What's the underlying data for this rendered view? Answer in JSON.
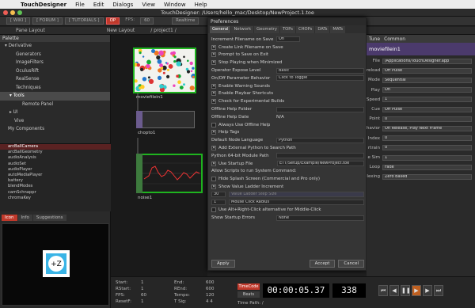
{
  "menubar": {
    "apple": "",
    "app": "TouchDesigner",
    "items": [
      "File",
      "Edit",
      "Dialogs",
      "View",
      "Window",
      "Help"
    ]
  },
  "window": {
    "title": "TouchDesigner: /Users/hello_mac/Desktop/NewProject.1.toe"
  },
  "toolbar": {
    "items": [
      "[ WIKI ]",
      "[ FORUM ]",
      "[ TUTORIALS ]",
      "OP",
      "FPS:",
      "60",
      "Realtime"
    ]
  },
  "pathbar": {
    "pane_layout": "Pane Layout",
    "new_layout": "New Layout",
    "path": "/ project1 /"
  },
  "palette": {
    "title": "Palette",
    "tree": [
      {
        "label": "Derivative",
        "level": 0,
        "open": true
      },
      {
        "label": "Generators",
        "level": 2
      },
      {
        "label": "ImageFilters",
        "level": 2
      },
      {
        "label": "OculusRift",
        "level": 2
      },
      {
        "label": "RealSense",
        "level": 2
      },
      {
        "label": "Techniques",
        "level": 2
      },
      {
        "label": "Tools",
        "level": 1,
        "open": true,
        "selected": true
      },
      {
        "label": "Remote Panel",
        "level": 3
      },
      {
        "label": "UI",
        "level": 1
      },
      {
        "label": "Vive",
        "level": 1
      },
      {
        "label": "My Components",
        "level": 0
      }
    ],
    "components": [
      "arcBallCamera",
      "arcBallGeometry",
      "audioAnalysis",
      "audioSet",
      "audioPlayer",
      "autoMediaPlayer",
      "battery",
      "blendModes",
      "camSchnappr",
      "chromaKey"
    ],
    "tabs": [
      "Icon",
      "Info",
      "Suggestions"
    ],
    "selected_component": "arcBallCamera"
  },
  "network": {
    "op1": "moviefilein1",
    "op2": "chopto1",
    "op3": "noise1"
  },
  "prefs": {
    "title": "Preferences",
    "tabs": [
      "General",
      "Network",
      "Geometry",
      "TOPs",
      "CHOPs",
      "DATs",
      "MATs"
    ],
    "active_tab": "General",
    "rows": [
      {
        "type": "field",
        "label": "Increment Filename on Save",
        "value": "On",
        "short": true
      },
      {
        "type": "check",
        "label": "Create Link Filename on Save",
        "checked": true
      },
      {
        "type": "check",
        "label": "Prompt to Save on Exit",
        "checked": true
      },
      {
        "type": "check",
        "label": "Stop Playing when Minimized",
        "checked": true
      },
      {
        "type": "field",
        "label": "Operator Expose Level",
        "value": "Basic"
      },
      {
        "type": "field",
        "label": "On/Off Parameter Behavior",
        "value": "Click to Toggle"
      },
      {
        "type": "check",
        "label": "Enable Warning Sounds",
        "checked": true
      },
      {
        "type": "check",
        "label": "Enable Playbar Shortcuts",
        "checked": true
      },
      {
        "type": "check",
        "label": "Check for Experimental Builds",
        "checked": true
      },
      {
        "type": "field",
        "label": "Offline Help Folder",
        "value": ""
      },
      {
        "type": "text",
        "label": "Offline Help Date",
        "value": "N/A"
      },
      {
        "type": "check",
        "label": "Always Use Offline Help",
        "checked": false
      },
      {
        "type": "check",
        "label": "Help Tags",
        "checked": true
      },
      {
        "type": "field",
        "label": "Default Node Language",
        "value": "Python"
      },
      {
        "type": "check",
        "label": "Add External Python to Search Path",
        "checked": true
      },
      {
        "type": "field",
        "label": "Python 64-bit Module Path",
        "value": ""
      },
      {
        "type": "check",
        "label": "Use Startup File",
        "checked": true,
        "value": "ETT/Setup/Example/NewProject.toe"
      },
      {
        "type": "heading",
        "label": "Allow Scripts to run System Command:"
      },
      {
        "type": "check",
        "label": "Hide Splash Screen (Commercial and Pro only)",
        "checked": false
      },
      {
        "type": "check",
        "label": "Show Value Ladder Increment",
        "checked": true
      },
      {
        "type": "num",
        "num": "30",
        "label": "Value Ladder Step Size",
        "dim": true
      },
      {
        "type": "num",
        "num": "1",
        "label": "Mouse Click Radius",
        "dim": false
      },
      {
        "type": "check",
        "label": "Use Alt+Right-Click alternative for Middle-Click",
        "checked": false
      },
      {
        "type": "field",
        "label": "Show Startup Errors",
        "value": "None"
      }
    ],
    "apply": "Apply",
    "accept": "Accept",
    "cancel": "Cancel"
  },
  "params": {
    "tabs": [
      "Tune",
      "Common"
    ],
    "title": "moviefilein1",
    "rows": [
      {
        "label": "File",
        "value": "/Applications/TouchDesigner.app"
      },
      {
        "label": "reload",
        "value": "Off     Pulse"
      },
      {
        "label": "Mode",
        "value": "Sequential"
      },
      {
        "label": "Play",
        "value": "On"
      },
      {
        "label": "Speed",
        "value": "1"
      },
      {
        "label": "Cue",
        "value": "Off     Pulse"
      },
      {
        "label": "Point",
        "value": "0"
      },
      {
        "label": "havior",
        "value": "On Release, Play Next Frame"
      },
      {
        "label": "Index",
        "value": "0"
      },
      {
        "label": "rtrain",
        "value": "0"
      },
      {
        "label": "e Sim",
        "value": "1"
      },
      {
        "label": "Loop",
        "value": "Fade"
      },
      {
        "label": "lexing",
        "value": "Zero Based"
      }
    ]
  },
  "timeline": {
    "stats_left": [
      [
        "Start:",
        "1"
      ],
      [
        "RStart:",
        "1"
      ],
      [
        "FPS:",
        "60"
      ],
      [
        "ResetF:",
        "1"
      ]
    ],
    "stats_mid": [
      [
        "End:",
        "600"
      ],
      [
        "REnd:",
        "600"
      ],
      [
        "Tempo:",
        "120"
      ],
      [
        "T Sig:",
        "4  4"
      ]
    ],
    "timecode_label": "TimeCode",
    "beats_label": "Beats",
    "timecode": "00:00:05.37",
    "frame": "338",
    "path": "Time Path: /"
  },
  "colors": {
    "accent": "#c0392b",
    "purple": "#4b3a6c",
    "op_green": "#1a8c1a"
  }
}
